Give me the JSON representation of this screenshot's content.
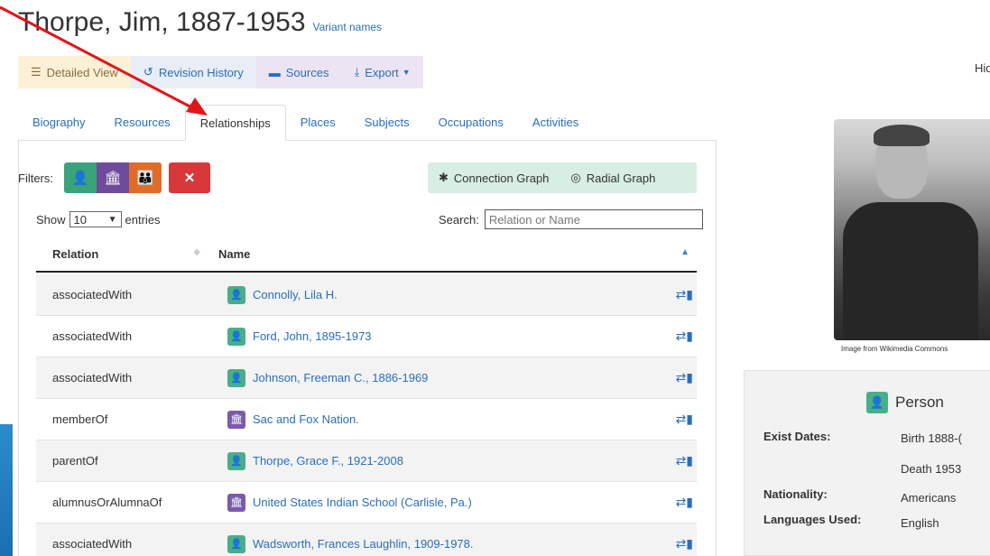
{
  "page": {
    "title": "Thorpe, Jim, 1887-1953",
    "variant_link": "Variant names",
    "hide_text": "Hid"
  },
  "toolbar": {
    "detailed_view": "Detailed View",
    "revision_history": "Revision History",
    "sources": "Sources",
    "export": "Export"
  },
  "tabs": [
    {
      "label": "Biography"
    },
    {
      "label": "Resources"
    },
    {
      "label": "Relationships"
    },
    {
      "label": "Places"
    },
    {
      "label": "Subjects"
    },
    {
      "label": "Occupations"
    },
    {
      "label": "Activities"
    }
  ],
  "active_tab": "Relationships",
  "filters": {
    "label": "Filters:"
  },
  "graphs": {
    "connection": "Connection Graph",
    "radial": "Radial Graph"
  },
  "table_controls": {
    "show_label": "Show",
    "entries_value": "10",
    "entries_label": "entries",
    "search_label": "Search:",
    "search_placeholder": "Relation or Name"
  },
  "table": {
    "headers": {
      "relation": "Relation",
      "name": "Name"
    },
    "rows": [
      {
        "relation": "associatedWith",
        "name": "Connolly, Lila H.",
        "type": "person"
      },
      {
        "relation": "associatedWith",
        "name": "Ford, John, 1895-1973",
        "type": "person"
      },
      {
        "relation": "associatedWith",
        "name": "Johnson, Freeman C., 1886-1969",
        "type": "person"
      },
      {
        "relation": "memberOf",
        "name": "Sac and Fox Nation.",
        "type": "org"
      },
      {
        "relation": "parentOf",
        "name": "Thorpe, Grace F., 1921-2008",
        "type": "person"
      },
      {
        "relation": "alumnusOrAlumnaOf",
        "name": "United States Indian School (Carlisle, Pa.)",
        "type": "org"
      },
      {
        "relation": "associatedWith",
        "name": "Wadsworth, Frances Laughlin, 1909-1978.",
        "type": "person"
      }
    ]
  },
  "sidebar": {
    "photo_caption": "Image from Wikimedia Commons",
    "entity_type": "Person",
    "exist_dates_label": "Exist Dates:",
    "birth": "Birth 1888-(",
    "death": "Death 1953",
    "nationality_label": "Nationality:",
    "nationality": "Americans",
    "languages_label": "Languages Used:",
    "languages": "English"
  },
  "colors": {
    "link": "#2a6ebb",
    "person": "#3aa37c",
    "organization": "#6f4c9b",
    "family": "#e06c2a",
    "clear": "#d9383a",
    "annotation_arrow": "#e0161b"
  }
}
